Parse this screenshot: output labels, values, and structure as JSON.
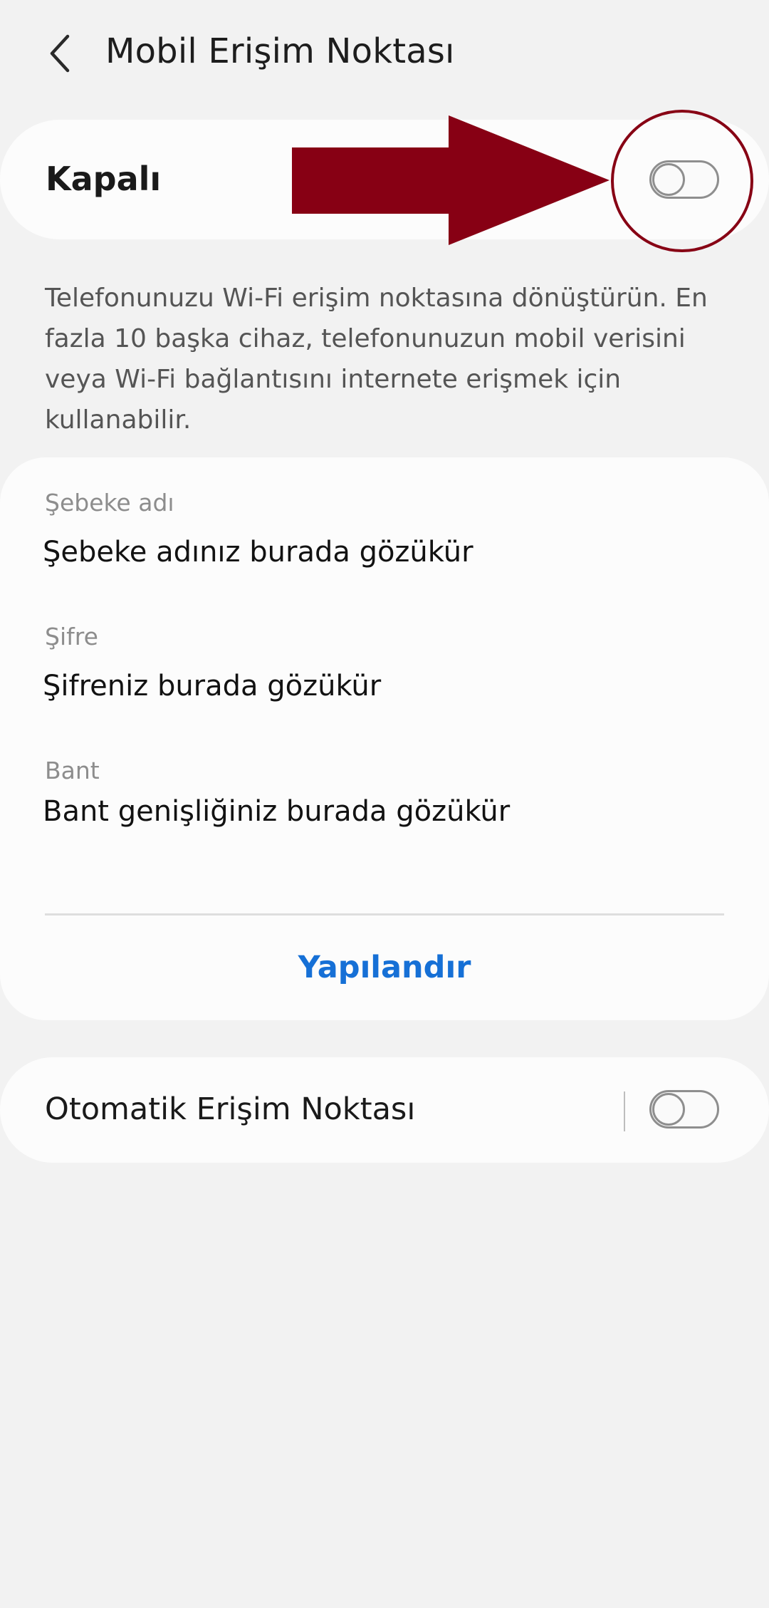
{
  "header": {
    "title": "Mobil Erişim Noktası",
    "back_icon": "chevron-left-icon"
  },
  "hotspot": {
    "status_label": "Kapalı",
    "enabled": false
  },
  "description": "Telefonunuzu Wi-Fi erişim noktasına dönüştürün. En fazla 10 başka cihaz, telefonunuzun mobil verisini veya Wi-Fi bağlantısını internete erişmek için kullanabilir.",
  "details": {
    "network_name_label": "Şebeke adı",
    "network_name_value": "Şebeke adınız burada gözükür",
    "password_label": "Şifre",
    "password_value": "Şifreniz burada gözükür",
    "band_label": "Bant",
    "band_value": "Bant genişliğiniz burada gözükür",
    "configure_label": "Yapılandır"
  },
  "auto_hotspot": {
    "label": "Otomatik Erişim Noktası",
    "enabled": false
  },
  "colors": {
    "background": "#f2f2f2",
    "card": "#fcfcfc",
    "accent": "#1670d6",
    "annotation": "#870014"
  }
}
